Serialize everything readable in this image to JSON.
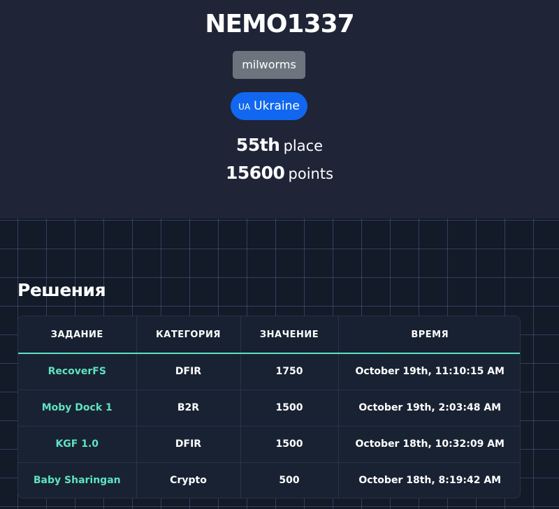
{
  "team": {
    "name": "NEMO1337",
    "affiliation": "milworms",
    "country_code": "UA",
    "country": "Ukraine",
    "place_number": "55th",
    "place_label": "place",
    "points_number": "15600",
    "points_label": "points"
  },
  "solves": {
    "title": "Решения",
    "columns": [
      "ЗАДАНИЕ",
      "КАТЕГОРИЯ",
      "ЗНАЧЕНИЕ",
      "ВРЕМЯ"
    ],
    "rows": [
      {
        "task": "RecoverFS",
        "category": "DFIR",
        "value": "1750",
        "time": "October 19th, 11:10:15 AM"
      },
      {
        "task": "Moby Dock 1",
        "category": "B2R",
        "value": "1500",
        "time": "October 19th, 2:03:48 AM"
      },
      {
        "task": "KGF 1.0",
        "category": "DFIR",
        "value": "1500",
        "time": "October 18th, 10:32:09 AM"
      },
      {
        "task": "Baby Sharingan",
        "category": "Crypto",
        "value": "500",
        "time": "October 18th, 8:19:42 AM"
      }
    ]
  },
  "colors": {
    "hero_bg": "#1f2537",
    "page_bg": "#131a28",
    "accent": "#5ee3c1",
    "country_badge": "#1167f0",
    "affiliation_badge": "#6c757d"
  }
}
